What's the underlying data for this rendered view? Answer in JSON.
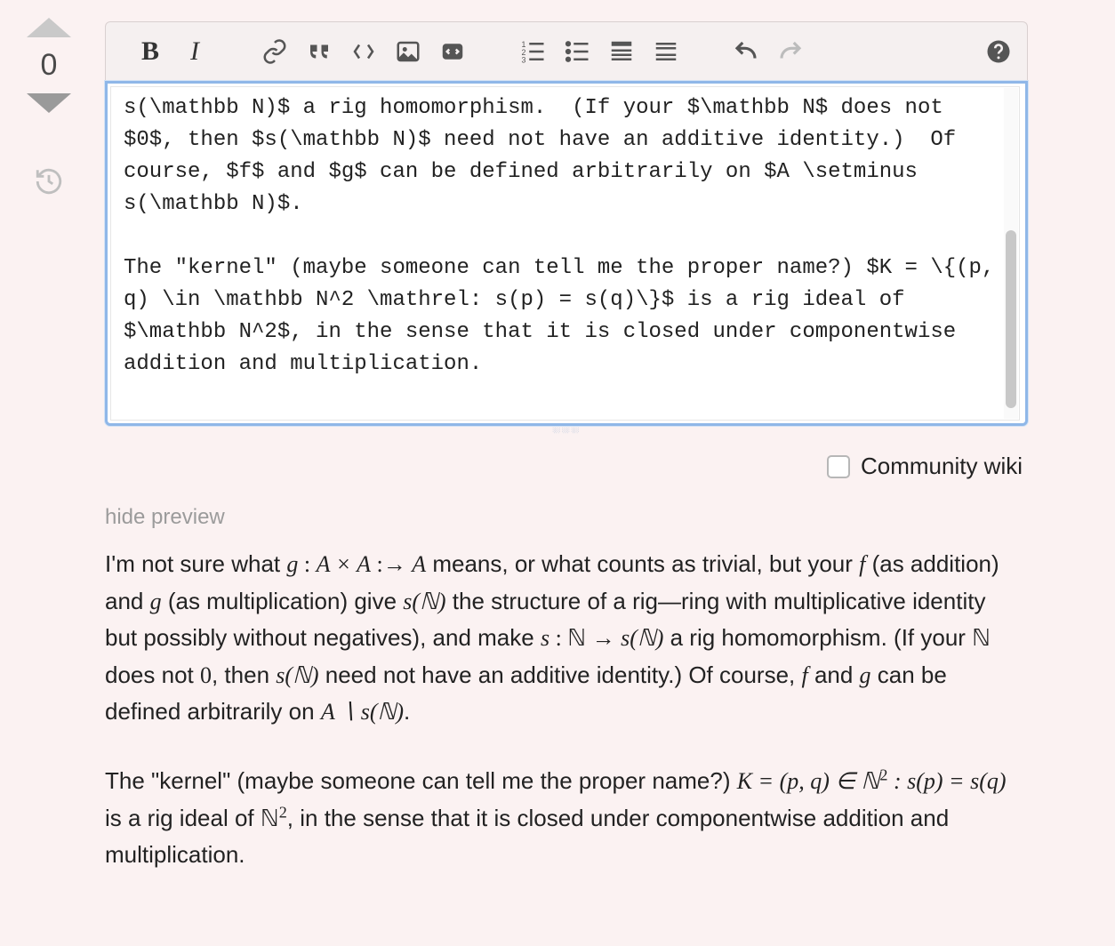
{
  "vote": {
    "score": "0"
  },
  "toolbar": {
    "bold": "B",
    "italic": "I"
  },
  "editor": {
    "content": "s(\\mathbb N)$ a rig homomorphism.  (If your $\\mathbb N$ does not $0$, then $s(\\mathbb N)$ need not have an additive identity.)  Of course, $f$ and $g$ can be defined arbitrarily on $A \\setminus s(\\mathbb N)$.\n\nThe \"kernel\" (maybe someone can tell me the proper name?) $K = \\{(p, q) \\in \\mathbb N^2 \\mathrel: s(p) = s(q)\\}$ is a rig ideal of $\\mathbb N^2$, in the sense that it is closed under componentwise addition and multiplication."
  },
  "community_wiki": {
    "label": "Community wiki"
  },
  "hide_preview": {
    "label": "hide preview"
  },
  "preview": {
    "p1_a": "I'm not sure what ",
    "p1_g": "g",
    "p1_b": " : ",
    "p1_AxA": "A × A",
    "p1_c": " :→ ",
    "p1_A": "A",
    "p1_d": " means, or what counts as trivial, but your ",
    "p1_f": "f",
    "p1_e": " (as addition) and ",
    "p1_g2": "g",
    "p1_f2": " (as multiplication) give ",
    "p1_sN": "s(ℕ)",
    "p1_g3": " the structure of a rig—ring with multiplicative identity but possibly without negatives), and make ",
    "p1_s": "s",
    "p1_h": " : ",
    "p1_N": "ℕ",
    "p1_i": " → ",
    "p1_sN2": "s(ℕ)",
    "p1_j": " a rig homomorphism. (If your ",
    "p1_N2": "ℕ",
    "p1_k": " does not ",
    "p1_zero": "0",
    "p1_l": ", then ",
    "p1_sN3": "s(ℕ)",
    "p1_m": " need not have an additive identity.) Of course, ",
    "p1_f3": "f",
    "p1_n": " and ",
    "p1_g4": "g",
    "p1_o": " can be defined arbitrarily on ",
    "p1_AsN": "A ∖ s(ℕ)",
    "p1_p": ".",
    "p2_a": "The \"kernel\" (maybe someone can tell me the proper name?) ",
    "p2_Keq": "K = (p, q) ∈ ℕ",
    "p2_sup": "2",
    "p2_b": " : s(p) = s(q)",
    "p2_c": " is a rig ideal of ",
    "p2_N2": "ℕ",
    "p2_sup2": "2",
    "p2_d": ", in the sense that it is closed under componentwise addition and multiplication."
  }
}
